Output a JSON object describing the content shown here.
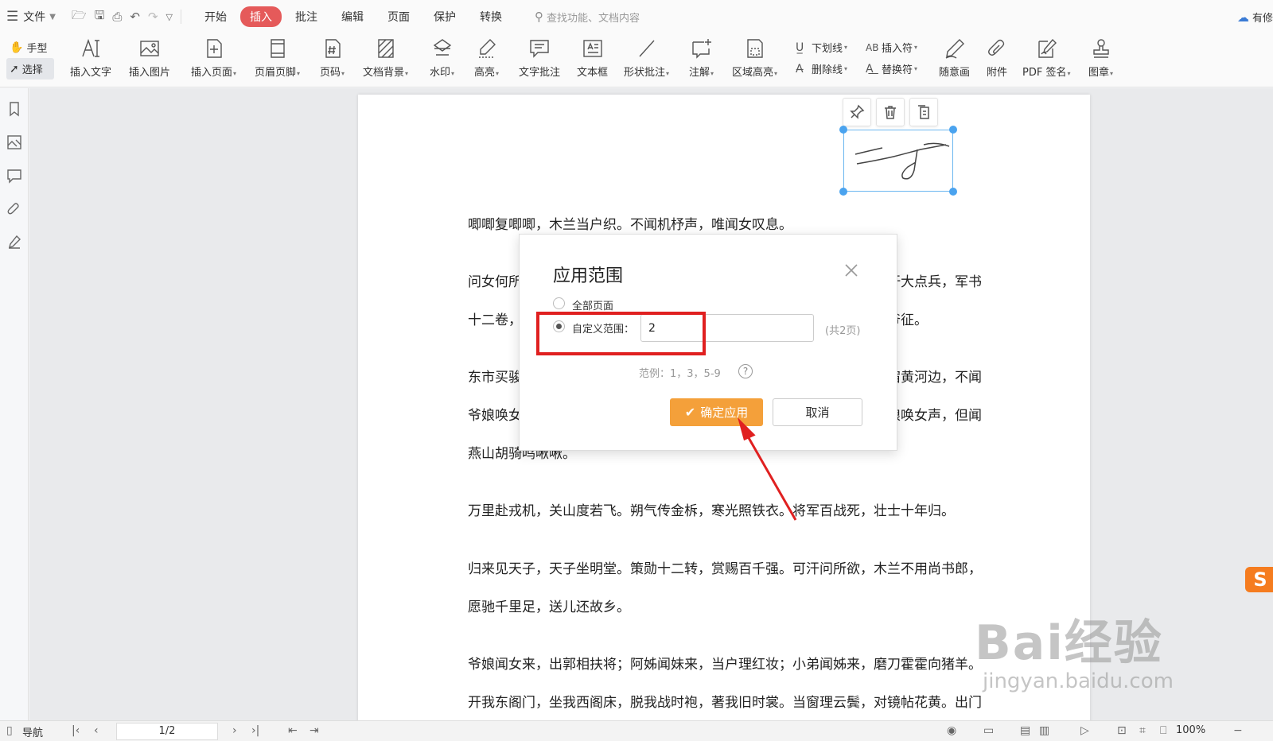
{
  "menubar": {
    "file_label": "文件",
    "tabs": [
      "开始",
      "插入",
      "批注",
      "编辑",
      "页面",
      "保护",
      "转换"
    ],
    "active_tab": "插入",
    "search_placeholder": "查找功能、文档内容",
    "cloud_label": "有修"
  },
  "ribbon": {
    "hand_label": "手型",
    "select_label": "选择",
    "items": [
      {
        "label": "插入文字",
        "icon": "insert-text-icon"
      },
      {
        "label": "插入图片",
        "icon": "insert-image-icon"
      },
      {
        "label": "插入页面",
        "icon": "insert-page-icon"
      },
      {
        "label": "页眉页脚",
        "icon": "header-footer-icon"
      },
      {
        "label": "页码",
        "icon": "page-number-icon"
      },
      {
        "label": "文档背景",
        "icon": "background-icon"
      },
      {
        "label": "水印",
        "icon": "watermark-icon"
      },
      {
        "label": "高亮",
        "icon": "highlight-icon"
      },
      {
        "label": "文字批注",
        "icon": "text-comment-icon"
      },
      {
        "label": "文本框",
        "icon": "textbox-icon"
      },
      {
        "label": "形状批注",
        "icon": "shape-comment-icon"
      },
      {
        "label": "注解",
        "icon": "note-icon"
      },
      {
        "label": "区域高亮",
        "icon": "area-highlight-icon"
      },
      {
        "label": "随意画",
        "icon": "freehand-icon"
      },
      {
        "label": "附件",
        "icon": "attachment-icon"
      },
      {
        "label": "PDF 签名",
        "icon": "pdf-sign-icon"
      },
      {
        "label": "图章",
        "icon": "stamp-icon"
      }
    ],
    "underline_label": "下划线",
    "strike_label": "删除线",
    "insert_symbol_label": "插入符",
    "replace_symbol_label": "替换符"
  },
  "document": {
    "paragraphs": [
      "唧唧复唧唧，木兰当户织。不闻机杼声，唯闻女叹息。",
      "问女何所思，问女何所忆。女亦无所思，女亦无所忆。昨夜见军帖，可汗大点兵，军书",
      "十二卷，卷卷有爷名。阿爷无大儿，木兰无长兄，愿为市鞍马，从此替爷征。",
      "东市买骏马，西市买鞍鞯，南市买辔头，北市买长鞭。旦辞爷娘去，暮宿黄河边，不闻",
      "爷娘唤女声，但闻黄河流水鸣溅溅。旦辞黄河去，暮至黑山头，不闻爷娘唤女声，但闻",
      "燕山胡骑鸣啾啾。",
      "万里赴戎机，关山度若飞。朔气传金柝，寒光照铁衣。将军百战死，壮士十年归。",
      "归来见天子，天子坐明堂。策勋十二转，赏赐百千强。可汗问所欲，木兰不用尚书郎，",
      "愿驰千里足，送儿还故乡。",
      "爷娘闻女来，出郭相扶将；阿姊闻妹来，当户理红妆；小弟闻姊来，磨刀霍霍向猪羊。",
      "开我东阁门，坐我西阁床，脱我战时袍，著我旧时裳。当窗理云鬓，对镜帖花黄。出门"
    ]
  },
  "dialog": {
    "title": "应用范围",
    "option_all": "全部页面",
    "option_custom": "自定义范围：",
    "custom_value": "2",
    "page_count": "(共2页)",
    "example": "范例：1，3，5-9",
    "help": "?",
    "ok_label": "确定应用",
    "cancel_label": "取消",
    "selected_option": "custom"
  },
  "statusbar": {
    "nav_label": "导航",
    "page_indicator": "1/2",
    "zoom": "100%"
  },
  "watermark": {
    "brand": "Bai经验",
    "url": "jingyan.baidu.com"
  },
  "colors": {
    "active_tab": "#e55a5a",
    "ok_button": "#f4a03a",
    "annotation_red": "#e02020",
    "selection_blue": "#4aa3ef"
  }
}
